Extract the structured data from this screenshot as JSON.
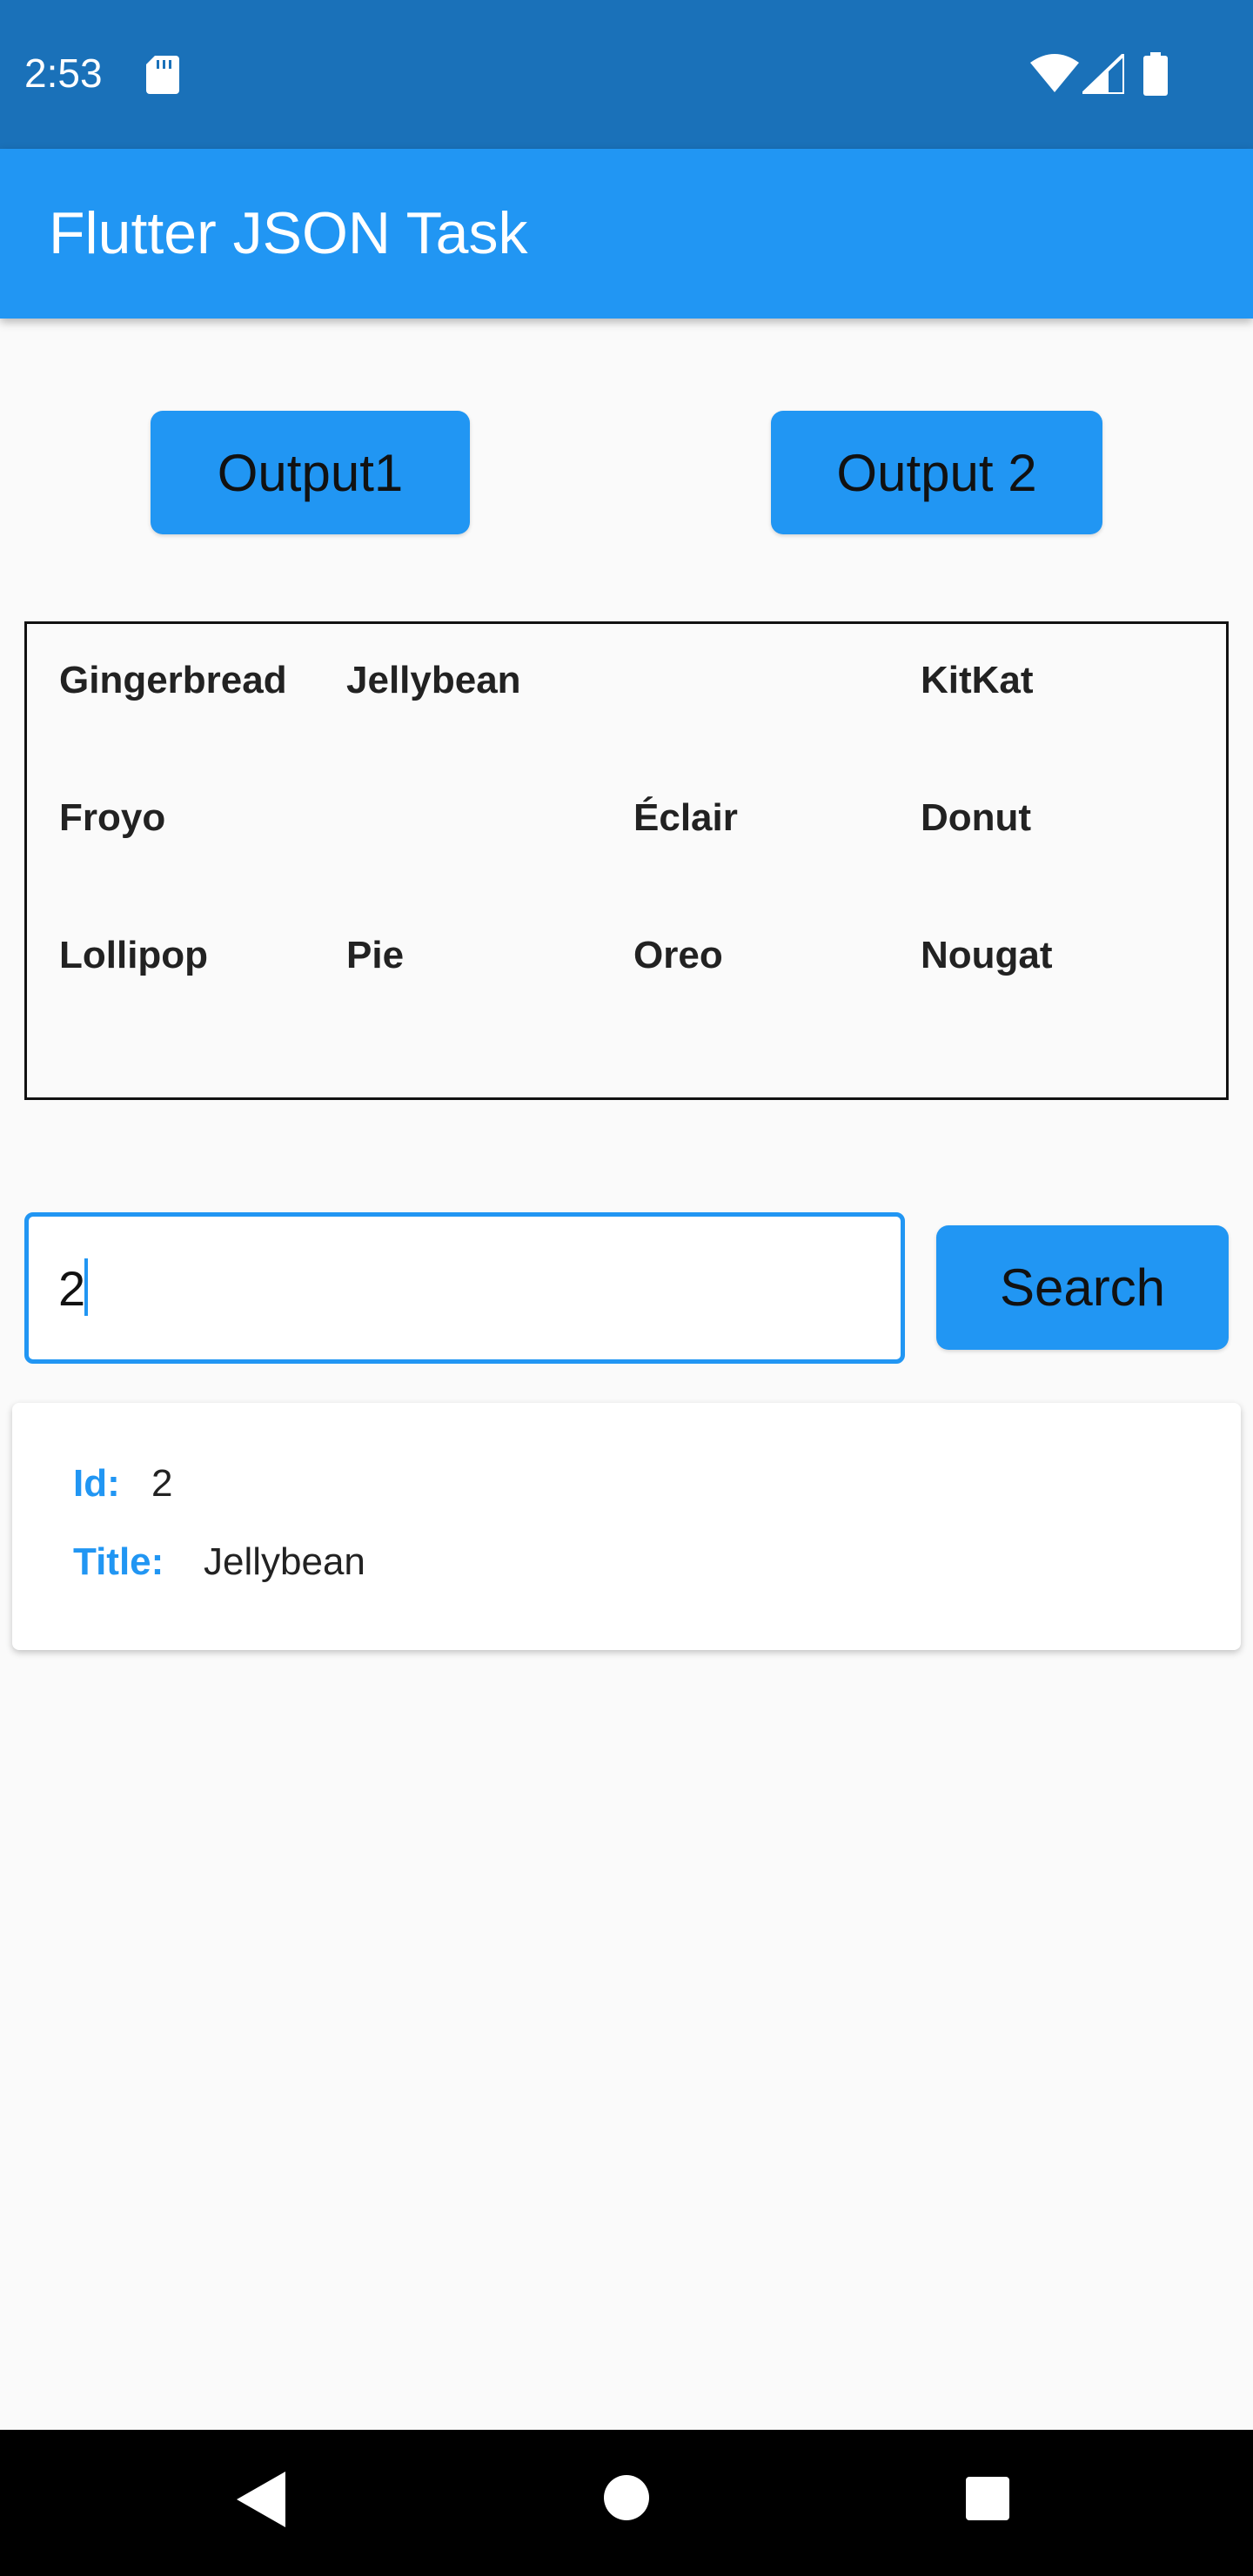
{
  "status_bar": {
    "time": "2:53",
    "icons": [
      "sd-card-icon",
      "wifi-icon",
      "signal-icon",
      "battery-icon"
    ]
  },
  "app_bar": {
    "title": "Flutter JSON Task"
  },
  "buttons": {
    "output1": "Output1",
    "output2": "Output 2",
    "search": "Search"
  },
  "grid": {
    "rows": [
      [
        "Gingerbread",
        "Jellybean",
        "",
        "KitKat"
      ],
      [
        "Froyo",
        "",
        "Éclair",
        "Donut"
      ],
      [
        "Lollipop",
        "Pie",
        "Oreo",
        "Nougat"
      ]
    ]
  },
  "search": {
    "value": "2"
  },
  "result": {
    "id_label": "Id:",
    "id_value": "2",
    "title_label": "Title:",
    "title_value": "Jellybean"
  },
  "nav_bar": {
    "icons": [
      "back-icon",
      "home-icon",
      "recents-icon"
    ]
  },
  "colors": {
    "primary": "#2196f3",
    "status_bar": "#1a71b9",
    "background": "#fafafa"
  }
}
